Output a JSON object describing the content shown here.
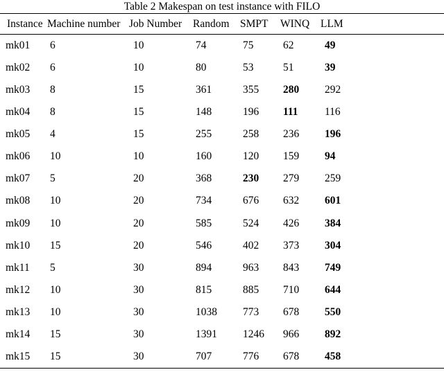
{
  "caption": "Table 2 Makespan on test instance with FILO",
  "table": {
    "columns": [
      "Instance",
      "Machine number",
      "Job Number",
      "Random",
      "SMPT",
      "WINQ",
      "LLM"
    ],
    "rows": [
      {
        "instance": "mk01",
        "machine_number": "6",
        "job_number": "10",
        "random": "74",
        "smpt": "75",
        "winq": "62",
        "llm": "49",
        "best": "llm"
      },
      {
        "instance": "mk02",
        "machine_number": "6",
        "job_number": "10",
        "random": "80",
        "smpt": "53",
        "winq": "51",
        "llm": "39",
        "best": "llm"
      },
      {
        "instance": "mk03",
        "machine_number": "8",
        "job_number": "15",
        "random": "361",
        "smpt": "355",
        "winq": "280",
        "llm": "292",
        "best": "winq"
      },
      {
        "instance": "mk04",
        "machine_number": "8",
        "job_number": "15",
        "random": "148",
        "smpt": "196",
        "winq": "111",
        "llm": "116",
        "best": "winq"
      },
      {
        "instance": "mk05",
        "machine_number": "4",
        "job_number": "15",
        "random": "255",
        "smpt": "258",
        "winq": "236",
        "llm": "196",
        "best": "llm"
      },
      {
        "instance": "mk06",
        "machine_number": "10",
        "job_number": "10",
        "random": "160",
        "smpt": "120",
        "winq": "159",
        "llm": "94",
        "best": "llm"
      },
      {
        "instance": "mk07",
        "machine_number": "5",
        "job_number": "20",
        "random": "368",
        "smpt": "230",
        "winq": "279",
        "llm": "259",
        "best": "smpt"
      },
      {
        "instance": "mk08",
        "machine_number": "10",
        "job_number": "20",
        "random": "734",
        "smpt": "676",
        "winq": "632",
        "llm": "601",
        "best": "llm"
      },
      {
        "instance": "mk09",
        "machine_number": "10",
        "job_number": "20",
        "random": "585",
        "smpt": "524",
        "winq": "426",
        "llm": "384",
        "best": "llm"
      },
      {
        "instance": "mk10",
        "machine_number": "15",
        "job_number": "20",
        "random": "546",
        "smpt": "402",
        "winq": "373",
        "llm": "304",
        "best": "llm"
      },
      {
        "instance": "mk11",
        "machine_number": "5",
        "job_number": "30",
        "random": "894",
        "smpt": "963",
        "winq": "843",
        "llm": "749",
        "best": "llm"
      },
      {
        "instance": "mk12",
        "machine_number": "10",
        "job_number": "30",
        "random": "815",
        "smpt": "885",
        "winq": "710",
        "llm": "644",
        "best": "llm"
      },
      {
        "instance": "mk13",
        "machine_number": "10",
        "job_number": "30",
        "random": "1038",
        "smpt": "773",
        "winq": "678",
        "llm": "550",
        "best": "llm"
      },
      {
        "instance": "mk14",
        "machine_number": "15",
        "job_number": "30",
        "random": "1391",
        "smpt": "1246",
        "winq": "966",
        "llm": "892",
        "best": "llm"
      },
      {
        "instance": "mk15",
        "machine_number": "15",
        "job_number": "30",
        "random": "707",
        "smpt": "776",
        "winq": "678",
        "llm": "458",
        "best": "llm"
      }
    ]
  },
  "chart_data": {
    "type": "table",
    "title": "Table 2 Makespan on test instance with FILO",
    "columns": [
      "Instance",
      "Machine number",
      "Job Number",
      "Random",
      "SMPT",
      "WINQ",
      "LLM"
    ],
    "series": [
      {
        "name": "Random",
        "values": [
          74,
          80,
          361,
          148,
          255,
          160,
          368,
          734,
          585,
          546,
          894,
          815,
          1038,
          1391,
          707
        ]
      },
      {
        "name": "SMPT",
        "values": [
          75,
          53,
          355,
          196,
          258,
          120,
          230,
          676,
          524,
          402,
          963,
          885,
          773,
          1246,
          776
        ]
      },
      {
        "name": "WINQ",
        "values": [
          62,
          51,
          280,
          111,
          236,
          159,
          279,
          632,
          426,
          373,
          843,
          710,
          678,
          966,
          678
        ]
      },
      {
        "name": "LLM",
        "values": [
          49,
          39,
          292,
          116,
          196,
          94,
          259,
          601,
          384,
          304,
          749,
          644,
          550,
          892,
          458
        ]
      }
    ],
    "categories": [
      "mk01",
      "mk02",
      "mk03",
      "mk04",
      "mk05",
      "mk06",
      "mk07",
      "mk08",
      "mk09",
      "mk10",
      "mk11",
      "mk12",
      "mk13",
      "mk14",
      "mk15"
    ],
    "machine_number": [
      6,
      6,
      8,
      8,
      4,
      10,
      5,
      10,
      10,
      15,
      5,
      10,
      10,
      15,
      15
    ],
    "job_number": [
      10,
      10,
      15,
      15,
      15,
      10,
      20,
      20,
      20,
      20,
      30,
      30,
      30,
      30,
      30
    ],
    "bold_marks_row_minimum": true,
    "xlabel": "Instance",
    "ylabel": "Makespan"
  }
}
